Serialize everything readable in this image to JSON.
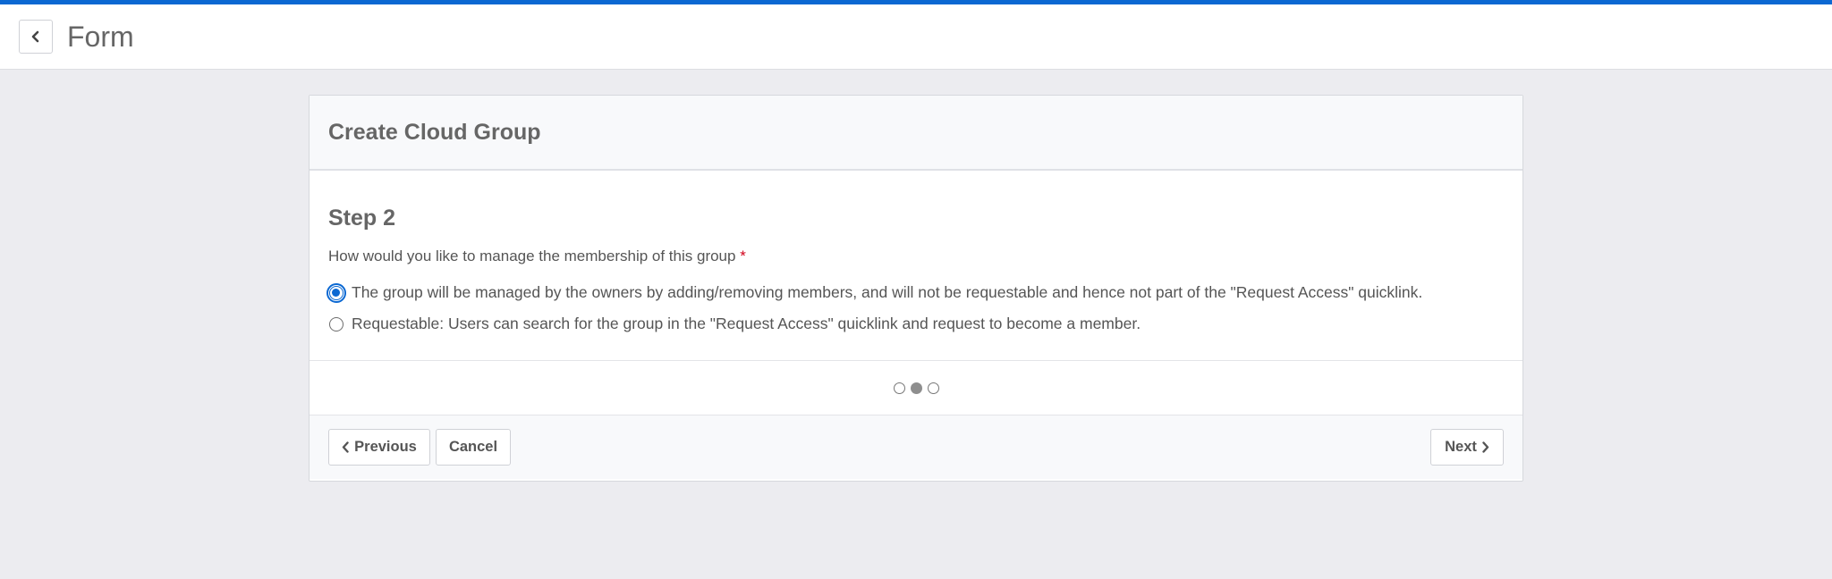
{
  "header": {
    "title": "Form",
    "back_icon": "chevron-left-icon"
  },
  "card": {
    "title": "Create Cloud Group",
    "step": {
      "title": "Step 2",
      "question": "How would you like to manage the membership of this group",
      "required_marker": "*",
      "options": [
        {
          "label": "The group will be managed by the owners by adding/removing members, and will not be requestable and hence not part of the \"Request Access\" quicklink.",
          "selected": true
        },
        {
          "label": "Requestable: Users can search for the group in the \"Request Access\" quicklink and request to become a member.",
          "selected": false
        }
      ]
    },
    "progress": {
      "total_steps": 3,
      "current_step": 2
    }
  },
  "footer": {
    "previous_label": "Previous",
    "cancel_label": "Cancel",
    "next_label": "Next"
  },
  "colors": {
    "accent": "#0b68d2",
    "required": "#d0021b",
    "background": "#ececf0"
  }
}
